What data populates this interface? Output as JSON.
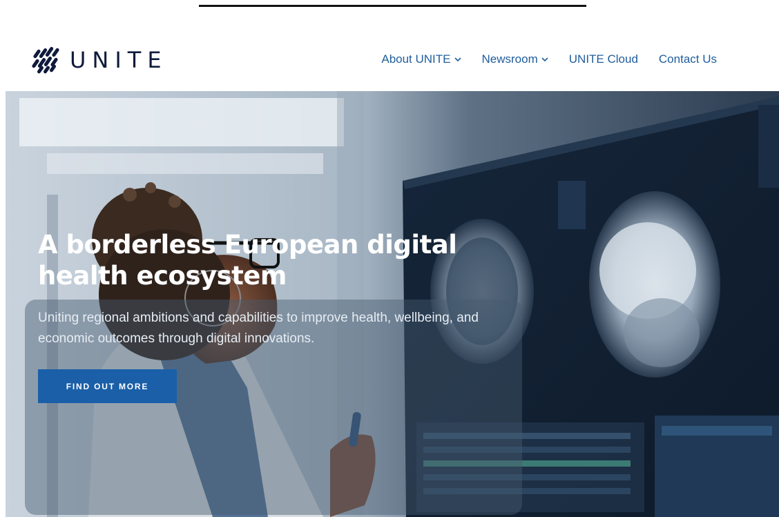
{
  "brand": {
    "name": "UNITE",
    "logo_icon": "unite-weave-icon",
    "color": "#0f1a3c"
  },
  "nav": {
    "items": [
      {
        "label": "About UNITE",
        "has_dropdown": true
      },
      {
        "label": "Newsroom",
        "has_dropdown": true
      },
      {
        "label": "UNITE Cloud",
        "has_dropdown": false
      },
      {
        "label": "Contact Us",
        "has_dropdown": false
      }
    ],
    "color": "#1f5d9c"
  },
  "hero": {
    "title": "A borderless European digital health ecosystem",
    "subtitle": "Uniting regional ambitions and capabilities to improve health, wellbeing, and economic outcomes through digital innovations.",
    "cta_label": "FIND OUT MORE",
    "cta_color": "#1a5fa8",
    "image": "woman-doctor-viewing-brain-mri-scans"
  }
}
